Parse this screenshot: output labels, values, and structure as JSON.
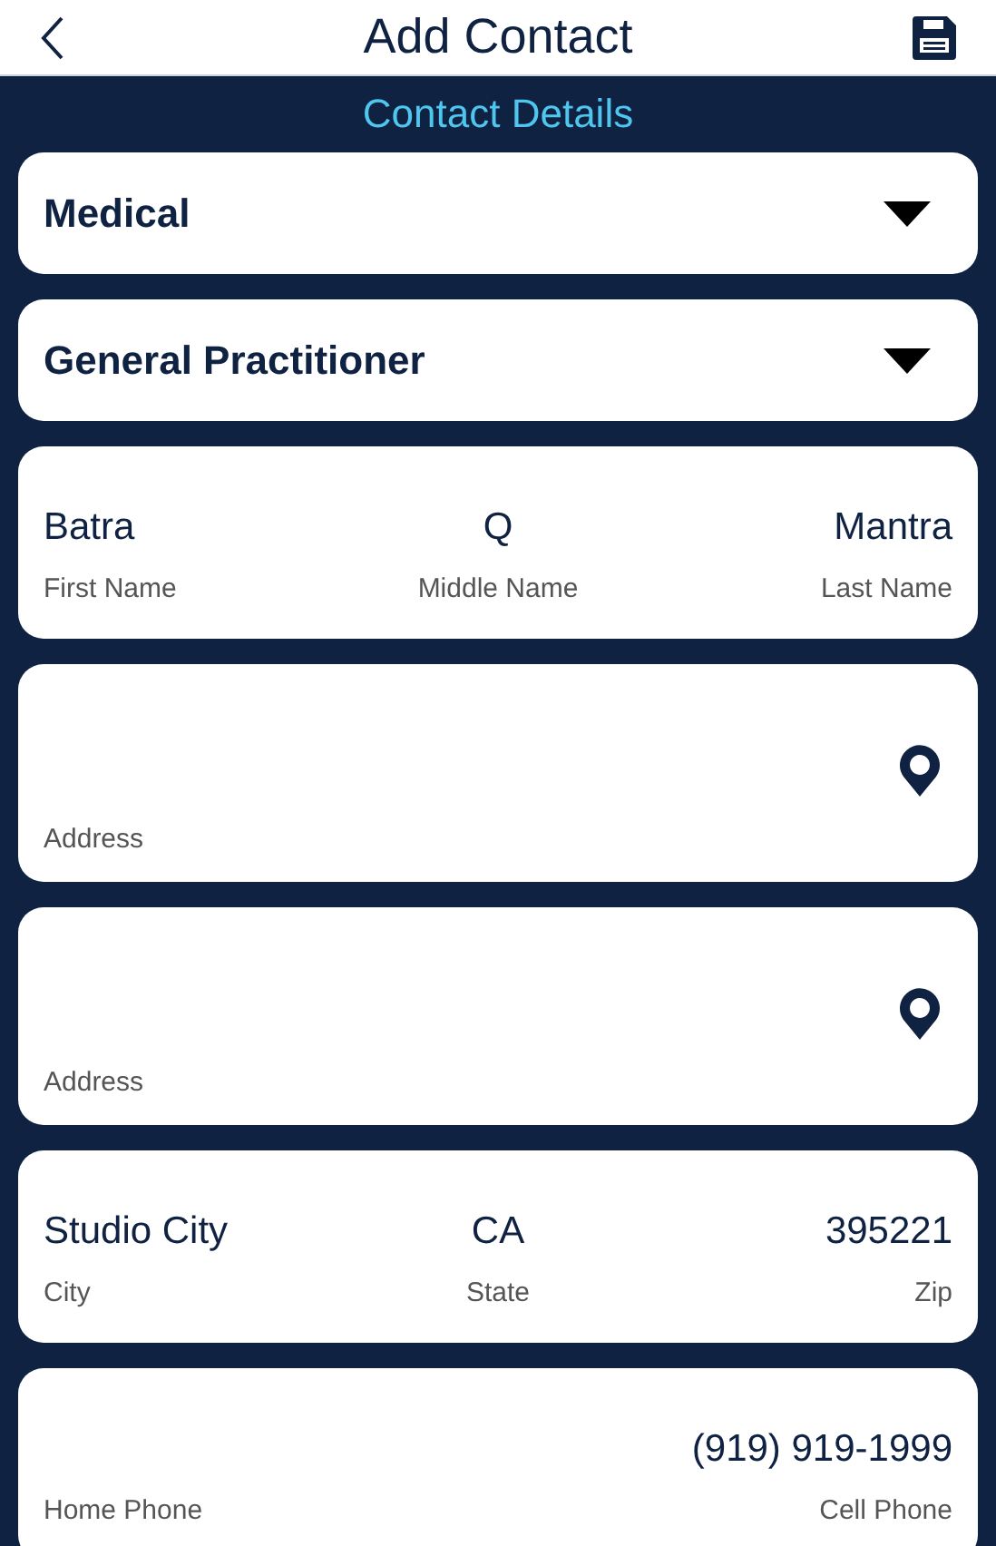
{
  "header": {
    "title": "Add Contact"
  },
  "section_title": "Contact Details",
  "cards": [
    {
      "kind": "dropdown",
      "value": "Medical"
    },
    {
      "kind": "dropdown",
      "value": "General Practitioner"
    },
    {
      "kind": "fields",
      "fields": [
        {
          "value": "Batra",
          "label": "First Name"
        },
        {
          "value": "Q",
          "label": "Middle Name"
        },
        {
          "value": "Mantra",
          "label": "Last Name"
        }
      ]
    },
    {
      "kind": "address",
      "label": "Address"
    },
    {
      "kind": "address",
      "label": "Address"
    },
    {
      "kind": "fields",
      "fields": [
        {
          "value": "Studio City",
          "label": "City"
        },
        {
          "value": "CA",
          "label": "State"
        },
        {
          "value": "395221",
          "label": "Zip"
        }
      ]
    },
    {
      "kind": "fields",
      "fields": [
        {
          "label": "Home Phone"
        },
        {
          "value": "(919) 919-1999",
          "label": "Cell Phone"
        }
      ]
    }
  ]
}
